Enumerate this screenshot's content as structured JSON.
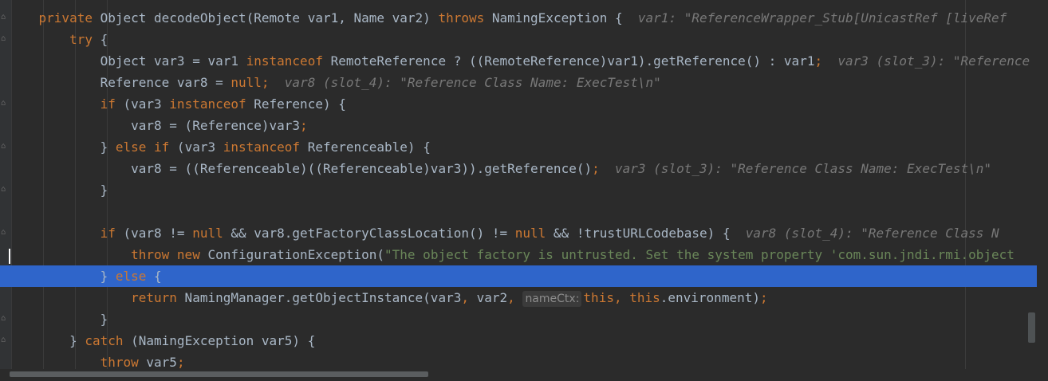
{
  "editor": {
    "language": "java",
    "lines": [
      [
        {
          "t": "    "
        },
        {
          "t": "private",
          "c": "kw"
        },
        {
          "t": " Object decodeObject(Remote var1, Name var2) "
        },
        {
          "t": "throws",
          "c": "kw"
        },
        {
          "t": " NamingException {  "
        },
        {
          "t": "var1: \"ReferenceWrapper_Stub[UnicastRef [liveRef",
          "c": "hint"
        }
      ],
      [
        {
          "t": "        "
        },
        {
          "t": "try",
          "c": "kw"
        },
        {
          "t": " {"
        }
      ],
      [
        {
          "t": "            Object var3 = var1 "
        },
        {
          "t": "instanceof",
          "c": "kw"
        },
        {
          "t": " RemoteReference ? ((RemoteReference)var1).getReference() : var1"
        },
        {
          "t": ";",
          "c": "kw"
        },
        {
          "t": "  "
        },
        {
          "t": "var3 (slot_3): \"Reference",
          "c": "hint"
        }
      ],
      [
        {
          "t": "            Reference var8 = "
        },
        {
          "t": "null",
          "c": "kw"
        },
        {
          "t": ";",
          "c": "kw"
        },
        {
          "t": "  "
        },
        {
          "t": "var8 (slot_4): \"Reference Class Name: ExecTest\\n\"",
          "c": "hint"
        }
      ],
      [
        {
          "t": "            "
        },
        {
          "t": "if",
          "c": "kw"
        },
        {
          "t": " (var3 "
        },
        {
          "t": "instanceof",
          "c": "kw"
        },
        {
          "t": " Reference) {"
        }
      ],
      [
        {
          "t": "                var8 = (Reference)var3"
        },
        {
          "t": ";",
          "c": "kw"
        }
      ],
      [
        {
          "t": "            } "
        },
        {
          "t": "else if",
          "c": "kw"
        },
        {
          "t": " (var3 "
        },
        {
          "t": "instanceof",
          "c": "kw"
        },
        {
          "t": " Referenceable) {"
        }
      ],
      [
        {
          "t": "                var8 = ((Referenceable)((Referenceable)var3)).getReference()"
        },
        {
          "t": ";",
          "c": "kw"
        },
        {
          "t": "  "
        },
        {
          "t": "var3 (slot_3): \"Reference Class Name: ExecTest\\n\"",
          "c": "hint"
        }
      ],
      [
        {
          "t": "            }"
        }
      ],
      [
        {
          "t": ""
        }
      ],
      [
        {
          "t": "            "
        },
        {
          "t": "if",
          "c": "kw"
        },
        {
          "t": " (var8 != "
        },
        {
          "t": "null",
          "c": "kw"
        },
        {
          "t": " && var8.getFactoryClassLocation() != "
        },
        {
          "t": "null",
          "c": "kw"
        },
        {
          "t": " && !trustURLCodebase) {  "
        },
        {
          "t": "var8 (slot_4): \"Reference Class N",
          "c": "hint"
        }
      ],
      [
        {
          "t": "                "
        },
        {
          "t": "throw new",
          "c": "kw"
        },
        {
          "t": " ConfigurationException("
        },
        {
          "t": "\"The object factory is untrusted. Set the system property 'com.sun.jndi.rmi.object",
          "c": "str"
        }
      ],
      [
        {
          "t": "            } "
        },
        {
          "t": "else",
          "c": "kw"
        },
        {
          "t": " {"
        }
      ],
      [
        {
          "t": "                "
        },
        {
          "t": "return",
          "c": "kw"
        },
        {
          "t": " NamingManager.getObjectInstance(var3"
        },
        {
          "t": ",",
          "c": "kw"
        },
        {
          "t": " var2"
        },
        {
          "t": ",",
          "c": "kw"
        },
        {
          "t": " "
        },
        {
          "t": "nameCtx:",
          "c": "param"
        },
        {
          "t": "this",
          "c": "kw"
        },
        {
          "t": ", ",
          "c": "kw"
        },
        {
          "t": "this",
          "c": "kw"
        },
        {
          "t": ".environment)"
        },
        {
          "t": ";",
          "c": "kw"
        }
      ],
      [
        {
          "t": "            }"
        }
      ],
      [
        {
          "t": "        } "
        },
        {
          "t": "catch",
          "c": "kw"
        },
        {
          "t": " (NamingException var5) {"
        }
      ],
      [
        {
          "t": "            "
        },
        {
          "t": "throw",
          "c": "kw"
        },
        {
          "t": " var5"
        },
        {
          "t": ";",
          "c": "kw"
        }
      ]
    ],
    "highlighted_line": 12
  }
}
